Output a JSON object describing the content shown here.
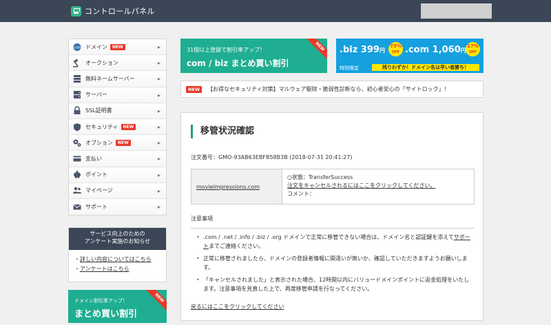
{
  "header": {
    "title": "コントロールパネル"
  },
  "sidebar": {
    "items": [
      {
        "label": "ドメイン",
        "new": true,
        "icon": "dotcom-icon"
      },
      {
        "label": "オークション",
        "new": false,
        "icon": "gavel-icon"
      },
      {
        "label": "無料ネームサーバー",
        "new": false,
        "icon": "server-icon"
      },
      {
        "label": "サーバー",
        "new": false,
        "icon": "server-stack-icon"
      },
      {
        "label": "SSL証明書",
        "new": false,
        "icon": "lock-icon"
      },
      {
        "label": "セキュリティ",
        "new": true,
        "icon": "shield-icon"
      },
      {
        "label": "オプション",
        "new": true,
        "icon": "gears-icon"
      },
      {
        "label": "支払い",
        "new": false,
        "icon": "card-icon"
      },
      {
        "label": "ポイント",
        "new": false,
        "icon": "piggy-icon"
      },
      {
        "label": "マイページ",
        "new": false,
        "icon": "users-icon"
      },
      {
        "label": "サポート",
        "new": false,
        "icon": "mail-icon"
      }
    ],
    "new_label": "NEW"
  },
  "survey": {
    "title_line1": "サービス向上のための",
    "title_line2": "アンケート実施のお知らせ",
    "link1_prefix": "・",
    "link1": "詳しい内容についてはこちら",
    "link2_prefix": "・",
    "link2": "アンケートはこちら"
  },
  "side_banner": {
    "small": "ドメイン割引率アップ！",
    "big": "まとめ買い割引",
    "ribbon": "NEW"
  },
  "banner1": {
    "small": "31個以上登録で割引率アップ！",
    "big": "com / biz まとめ買い割引",
    "ribbon": "NEW"
  },
  "banner2": {
    "biz_price": ".biz 399",
    "biz_unit": "円",
    "biz_off": "73%",
    "biz_off_label": "OFF",
    "com_price": ".com 1,060",
    "com_unit": "円",
    "com_off": "17%",
    "com_off_label": "OFF",
    "tag": "特別限定",
    "strip": "残りわずか！ドメイン名は早い者勝ち！"
  },
  "notice": {
    "badge": "NEW",
    "text": "【お得なセキュリティ対策】マルウェア駆除・脆弱性診断なら、初心者安心の「サイトロック」！"
  },
  "main": {
    "title": "移管状況確認",
    "order": "注文番号：GMO-93AB63EBFB58B3B (2018-07-31 20:41:27)",
    "domain": "movieimpressions.com",
    "status": "○状態：TransferSuccess",
    "cancel_link": "注文をキャンセルされるにはここをクリックしてください。",
    "comment": "コメント：",
    "notes_head": "注意事項",
    "note1_a": ".com / .net / .info / .biz / .org ドメインで正常に移管できない場合は、ドメイン名と認証鍵を添えて",
    "note1_link": "サポート",
    "note1_b": "までご連絡ください。",
    "note2": "正常に移管されましたら、ドメインの登録者情報に間違いが無いか、確認していただきますようお願いします。",
    "note3": "「キャンセルされました」と表示された場合、12時間以内にバリュードメインポイントに返金処理をいたします。注意事項を見直した上で、再度移管申請を行なってください。",
    "back": "戻るにはここをクリックしてください"
  }
}
